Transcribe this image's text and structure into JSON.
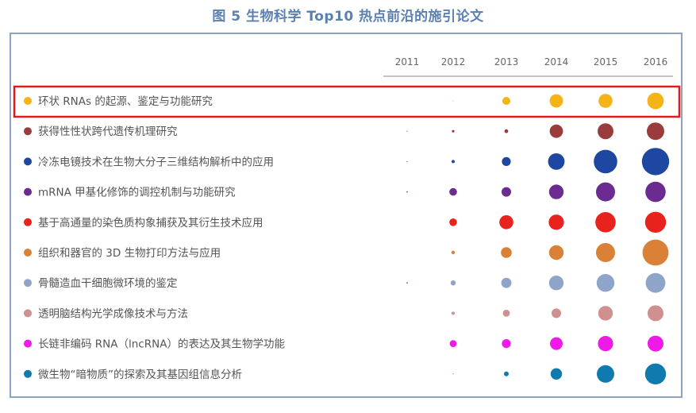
{
  "title": "图 5 生物科学 Top10 热点前沿的施引论文",
  "chart_data": {
    "type": "bubble",
    "title": "图 5 生物科学 Top10 热点前沿的施引论文",
    "years": [
      "2011",
      "2012",
      "2013",
      "2014",
      "2015",
      "2016"
    ],
    "highlighted_index": 0,
    "rows": [
      {
        "label": "环状 RNAs 的起源、鉴定与功能研究",
        "color": "#f4b418",
        "values": [
          0,
          0.2,
          2.5,
          4.2,
          4.4,
          5.2
        ]
      },
      {
        "label": "获得性性状跨代遗传机理研究",
        "color": "#9b3c3c",
        "values": [
          0.2,
          0.8,
          1.2,
          4.2,
          5.0,
          5.5
        ]
      },
      {
        "label": "冷冻电镜技术在生物大分子三维结构解析中的应用",
        "color": "#1d47a0",
        "values": [
          0.2,
          1.0,
          2.8,
          5.2,
          7.4,
          8.6
        ]
      },
      {
        "label": "mRNA 甲基化修饰的调控机制与功能研究",
        "color": "#6b2b90",
        "values": [
          0.4,
          2.4,
          3.0,
          4.6,
          6.0,
          6.4
        ]
      },
      {
        "label": "基于高通量的染色质构象捕获及其衍生技术应用",
        "color": "#e8221c",
        "values": [
          0,
          2.4,
          4.4,
          4.8,
          6.4,
          6.6
        ]
      },
      {
        "label": "组织和器官的 3D 生物打印方法与应用",
        "color": "#d98137",
        "values": [
          0,
          1.1,
          3.4,
          4.6,
          6.0,
          8.2
        ]
      },
      {
        "label": "骨髓造血干细胞微环境的鉴定",
        "color": "#8ea4c8",
        "values": [
          0.6,
          1.6,
          3.2,
          4.6,
          5.6,
          6.2
        ]
      },
      {
        "label": "透明脑结构光学成像技术与方法",
        "color": "#d09090",
        "values": [
          0,
          1.0,
          2.2,
          3.0,
          4.6,
          5.0
        ]
      },
      {
        "label": "长链非编码 RNA（lncRNA）的表达及其生物学功能",
        "color": "#ef1ae8",
        "values": [
          0,
          2.2,
          2.8,
          4.0,
          4.8,
          5.0
        ]
      },
      {
        "label": "微生物“暗物质”的探索及其基因组信息分析",
        "color": "#0e7aad",
        "values": [
          0,
          0.2,
          1.5,
          3.6,
          5.5,
          6.6
        ]
      }
    ]
  }
}
